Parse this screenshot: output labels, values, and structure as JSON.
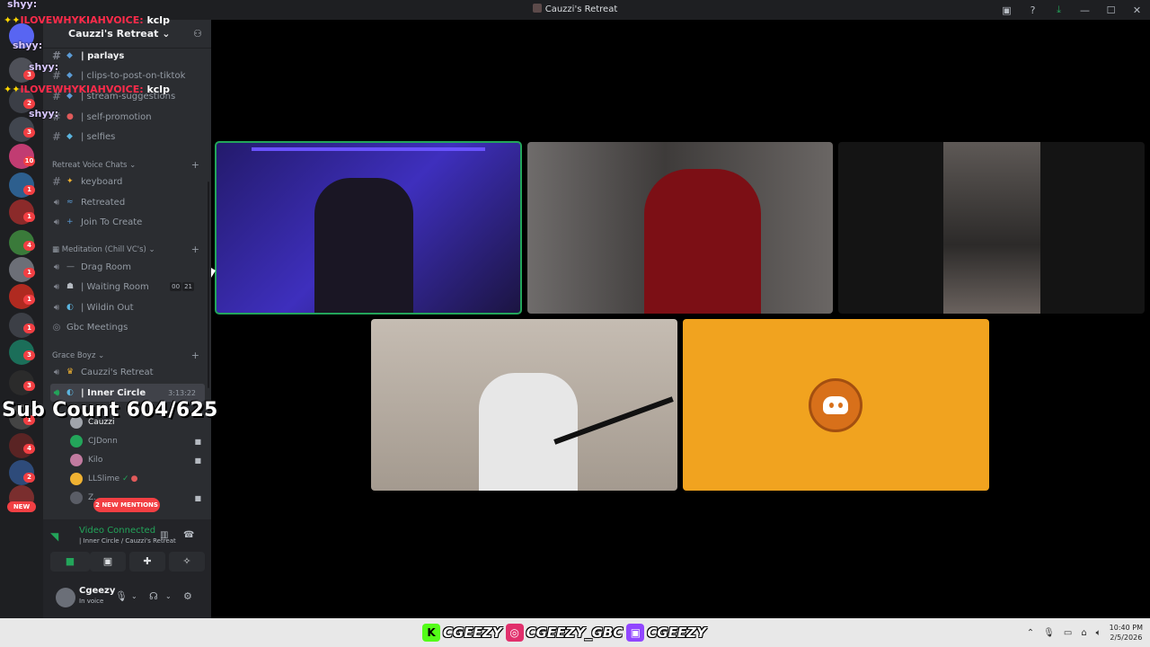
{
  "window": {
    "title": "Cauzzi's Retreat"
  },
  "server": {
    "name": "Cauzzi's Retreat"
  },
  "overlay": {
    "chat_lines": [
      {
        "name": "ILOVEWHYKIAHVOICE:",
        "message": "kclp"
      },
      {
        "name": "ILOVEWHYKIAHVOICE:",
        "message": "kclp"
      }
    ],
    "shy_tags": [
      "shyy:",
      "shyy:",
      "shyy:",
      "shyy:"
    ],
    "sub_count": "Sub Count 604/625"
  },
  "guild_badges": [
    "3",
    "2",
    "3",
    "10",
    "1",
    "1",
    "4",
    "1",
    "1",
    "1",
    "3",
    "3",
    "1",
    "4",
    "2",
    "4"
  ],
  "new_label": "NEW",
  "text_channels": [
    {
      "label": "| parlays"
    },
    {
      "label": "| clips-to-post-on-tiktok"
    },
    {
      "label": "| stream-suggestions"
    },
    {
      "label": "| self-promotion"
    },
    {
      "label": "| selfies"
    }
  ],
  "categories": {
    "retreat_voice": "Retreat Voice Chats",
    "meditation": "Meditation (Chill VC's)",
    "grace": "Grace Boyz"
  },
  "voice_channels_retreat": [
    {
      "label": "keyboard"
    },
    {
      "label": "Retreated"
    },
    {
      "label": "Join To Create"
    }
  ],
  "voice_channels_meditation": [
    {
      "label": "Drag Room"
    },
    {
      "label": "| Waiting Room",
      "limit_current": "00",
      "limit_max": "21"
    },
    {
      "label": "| Wildin Out"
    },
    {
      "label": "Gbc Meetings"
    }
  ],
  "voice_channels_grace": [
    {
      "label": "Cauzzi's Retreat"
    },
    {
      "label": "| Inner Circle",
      "timer": "3:13:22"
    }
  ],
  "voice_users": [
    {
      "name": "Cauzzi",
      "color": "#a0a4ab"
    },
    {
      "name": "CJDonn",
      "color": "#23a55a"
    },
    {
      "name": "Kilo",
      "color": "#c27ba0"
    },
    {
      "name": "LLSlime",
      "color": "#f0b232"
    },
    {
      "name": "Z..."
    }
  ],
  "mentions_label": "2 NEW MENTIONS",
  "voice_panel": {
    "status": "Video Connected",
    "location": "| Inner Circle / Cauzzi's Retreat"
  },
  "user_panel": {
    "name": "Cgeezy",
    "status": "In voice"
  },
  "taskbar": {
    "socials": [
      {
        "icon": "kick-icon",
        "handle": "CGEEZY",
        "color": "#53fc18"
      },
      {
        "icon": "instagram-icon",
        "handle": "CGEEZY_GBC",
        "color": "#e1306c"
      },
      {
        "icon": "twitch-icon",
        "handle": "CGEEZY",
        "color": "#9146ff"
      }
    ],
    "time": "10:40 PM",
    "date": "2/5/2026"
  }
}
